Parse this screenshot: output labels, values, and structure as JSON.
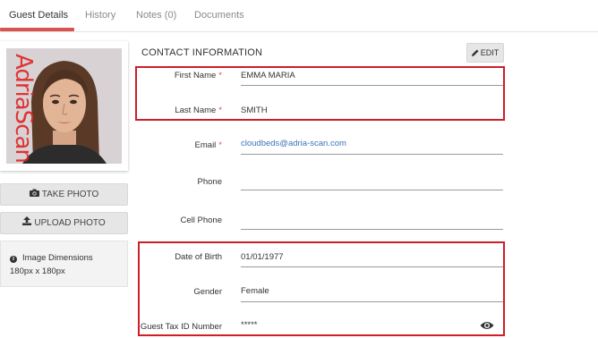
{
  "tabs": [
    {
      "label": "Guest Details",
      "active": true
    },
    {
      "label": "History",
      "active": false
    },
    {
      "label": "Notes (0)",
      "active": false
    },
    {
      "label": "Documents",
      "active": false
    }
  ],
  "photo": {
    "watermark": "AdriaScan"
  },
  "left": {
    "take_photo": "TAKE PHOTO",
    "upload_photo": "UPLOAD PHOTO",
    "image_dimensions_title": "Image Dimensions",
    "image_dimensions_value": "180px x 180px",
    "icons": [
      "camera-icon",
      "upload-icon",
      "info-icon"
    ]
  },
  "contact": {
    "title": "CONTACT INFORMATION",
    "edit_label": "EDIT",
    "fields": {
      "first_name": {
        "label": "First Name",
        "required": "*",
        "value": "EMMA MARIA"
      },
      "last_name": {
        "label": "Last Name",
        "required": "*",
        "value": "SMITH"
      },
      "email": {
        "label": "Email",
        "required": "*",
        "value": "cloudbeds@adria-scan.com"
      },
      "phone": {
        "label": "Phone",
        "value": ""
      },
      "cell_phone": {
        "label": "Cell Phone",
        "value": ""
      },
      "dob": {
        "label": "Date of Birth",
        "value": "01/01/1977"
      },
      "gender": {
        "label": "Gender",
        "value": "Female"
      },
      "tax_id": {
        "label": "Guest Tax ID Number",
        "value": "*****"
      }
    }
  },
  "colors": {
    "accent_red": "#d9534f",
    "highlight_border": "#cc1f26",
    "link_blue": "#3b74b8"
  }
}
